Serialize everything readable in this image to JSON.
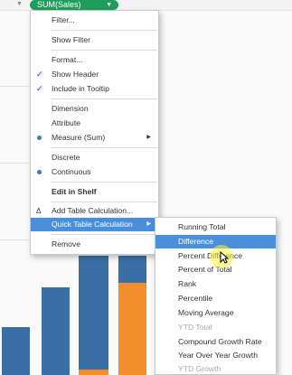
{
  "shelf": {
    "pill_label": "SUM(Sales)"
  },
  "colors": {
    "pill": "#1e9e5a",
    "highlight": "#4a8fdb",
    "bar_blue": "#3b6ea5",
    "bar_orange": "#f28e2b"
  },
  "menu": {
    "items": [
      {
        "label": "Filter..."
      },
      {
        "label": "Show Filter"
      },
      {
        "label": "Format..."
      },
      {
        "label": "Show Header",
        "checked": true
      },
      {
        "label": "Include in Tooltip",
        "checked": true
      },
      {
        "label": "Dimension"
      },
      {
        "label": "Attribute"
      },
      {
        "label": "Measure (Sum)",
        "selected": true,
        "submenu": true
      },
      {
        "label": "Discrete"
      },
      {
        "label": "Continuous",
        "selected": true
      },
      {
        "label": "Edit in Shelf"
      },
      {
        "label": "Add Table Calculation..."
      },
      {
        "label": "Quick Table Calculation",
        "submenu": true,
        "highlighted": true
      },
      {
        "label": "Remove"
      }
    ]
  },
  "submenu": {
    "items": [
      {
        "label": "Running Total"
      },
      {
        "label": "Difference",
        "highlighted": true
      },
      {
        "label": "Percent Difference"
      },
      {
        "label": "Percent of Total"
      },
      {
        "label": "Rank"
      },
      {
        "label": "Percentile"
      },
      {
        "label": "Moving Average"
      },
      {
        "label": "YTD Total",
        "disabled": true
      },
      {
        "label": "Compound Growth Rate"
      },
      {
        "label": "Year Over Year Growth"
      },
      {
        "label": "YTD Growth",
        "disabled": true
      }
    ]
  }
}
